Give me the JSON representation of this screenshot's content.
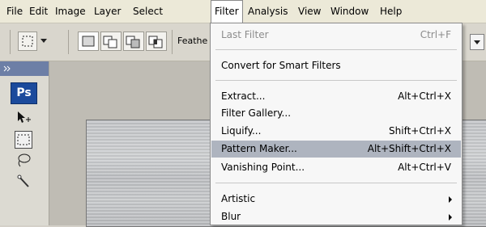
{
  "menubar": {
    "items": [
      {
        "label": "File"
      },
      {
        "label": "Edit"
      },
      {
        "label": "Image"
      },
      {
        "label": "Layer"
      },
      {
        "label": "Select"
      },
      {
        "label": "Filter",
        "active": true
      },
      {
        "label": "Analysis"
      },
      {
        "label": "View"
      },
      {
        "label": "Window"
      },
      {
        "label": "Help"
      }
    ]
  },
  "options_bar": {
    "feather_label": "Feathe"
  },
  "toolbox": {
    "logo_text": "Ps"
  },
  "filter_menu": {
    "items": [
      {
        "label": "Last Filter",
        "shortcut": "Ctrl+F",
        "disabled": true
      },
      {
        "label": "Convert for Smart Filters",
        "shortcut": ""
      },
      {
        "label": "Extract...",
        "shortcut": "Alt+Ctrl+X"
      },
      {
        "label": "Filter Gallery...",
        "shortcut": ""
      },
      {
        "label": "Liquify...",
        "shortcut": "Shift+Ctrl+X"
      },
      {
        "label": "Pattern Maker...",
        "shortcut": "Alt+Shift+Ctrl+X",
        "highlighted": true
      },
      {
        "label": "Vanishing Point...",
        "shortcut": "Alt+Ctrl+V"
      },
      {
        "label": "Artistic",
        "submenu": true
      },
      {
        "label": "Blur",
        "submenu": true
      }
    ]
  },
  "colors": {
    "highlight": "#aeb4bf",
    "ps_logo": "#1b4a9c",
    "menu_bg": "#f7f7f7"
  }
}
